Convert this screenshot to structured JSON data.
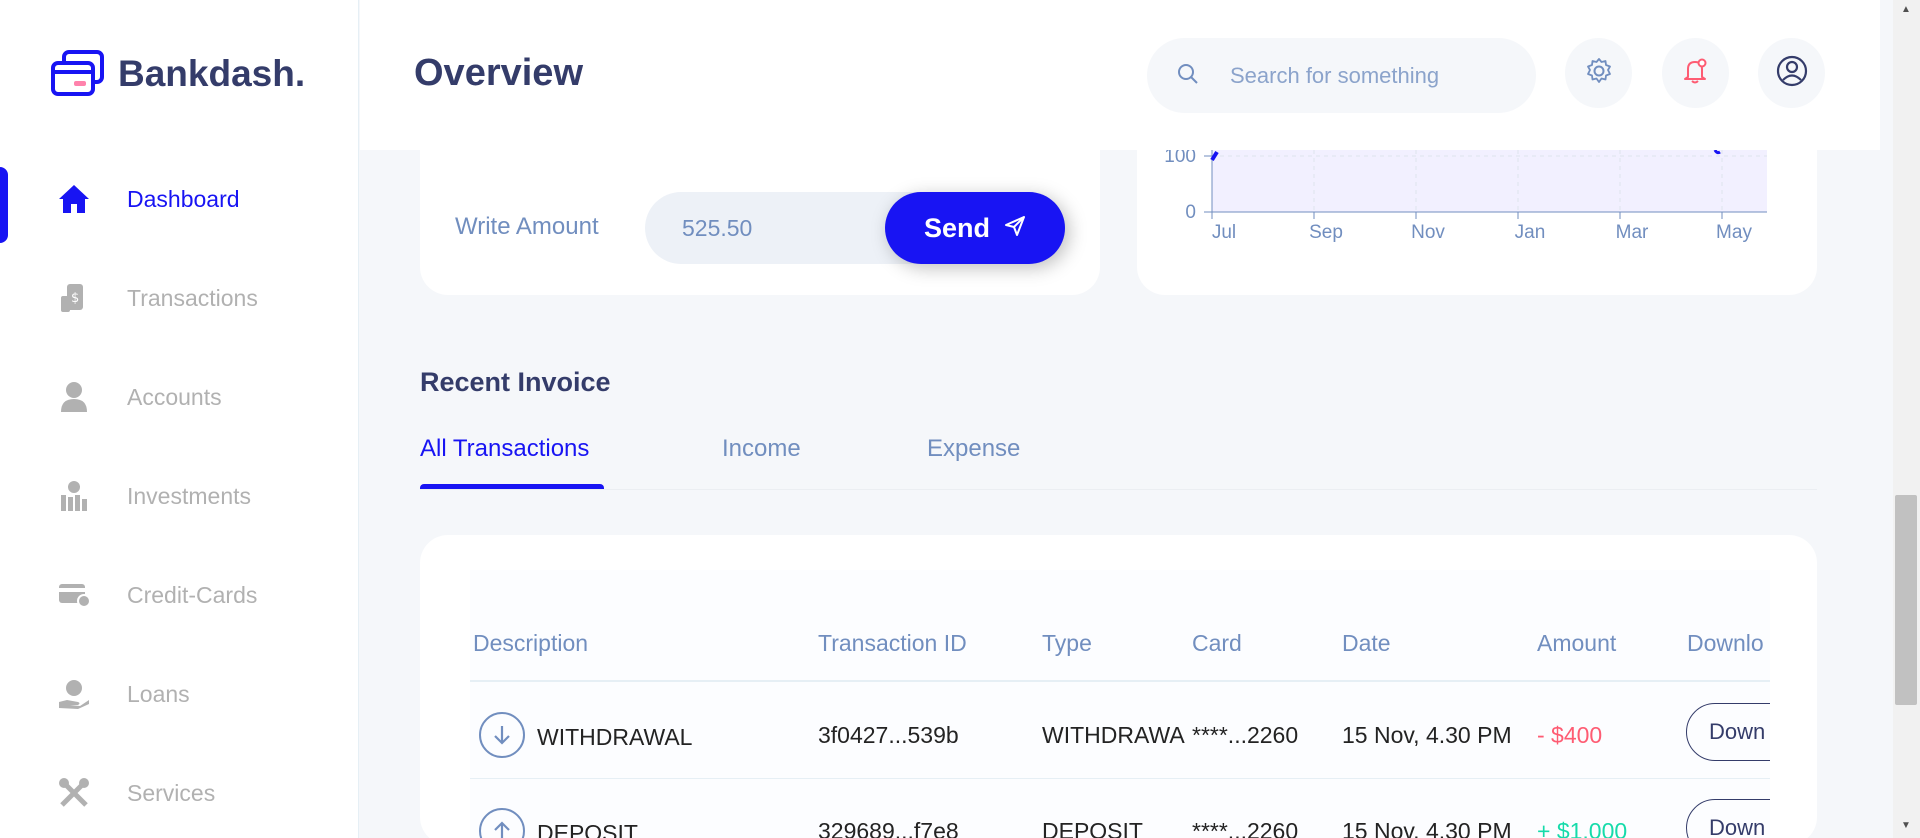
{
  "app": {
    "name": "Bankdash."
  },
  "sidebar": {
    "items": [
      {
        "label": "Dashboard",
        "icon": "home-icon",
        "active": true
      },
      {
        "label": "Transactions",
        "icon": "transfer-icon"
      },
      {
        "label": "Accounts",
        "icon": "user-icon"
      },
      {
        "label": "Investments",
        "icon": "investment-icon"
      },
      {
        "label": "Credit-Cards",
        "icon": "credit-card-icon"
      },
      {
        "label": "Loans",
        "icon": "loan-icon"
      },
      {
        "label": "Services",
        "icon": "services-icon"
      }
    ]
  },
  "header": {
    "title": "Overview",
    "search_placeholder": "Search for something",
    "icons": [
      "gear-icon",
      "notification-icon",
      "profile-icon"
    ]
  },
  "quick_transfer": {
    "amount_label": "Write Amount",
    "amount_value": "525.50",
    "send_label": "Send"
  },
  "chart": {
    "y_ticks": [
      "100",
      "0"
    ],
    "x_ticks": [
      "Jul",
      "Sep",
      "Nov",
      "Jan",
      "Mar",
      "May"
    ]
  },
  "chart_data": {
    "type": "line",
    "x": [
      "Jul",
      "Sep",
      "Nov",
      "Jan",
      "Mar",
      "May"
    ],
    "y_ticks": [
      0,
      100
    ],
    "grid": true,
    "accent": "#1814f3"
  },
  "invoice": {
    "title": "Recent Invoice",
    "tabs": [
      "All Transactions",
      "Income",
      "Expense"
    ],
    "active_tab": "All Transactions",
    "columns": [
      "Description",
      "Transaction ID",
      "Type",
      "Card",
      "Date",
      "Amount",
      "Downlo"
    ],
    "rows": [
      {
        "description": "WITHDRAWAL",
        "direction": "down-arrow-icon",
        "id": "3f0427...539b",
        "type": "WITHDRAWA",
        "card": "****...2260",
        "date": "15 Nov, 4.30 PM",
        "amount": "- $400",
        "download": "Down"
      },
      {
        "description": "DEPOSIT",
        "direction": "up-arrow-icon",
        "id": "329689...f7e8",
        "type": "DEPOSIT",
        "card": "****...2260",
        "date": "15 Nov, 4.30 PM",
        "amount": "+ $1,000",
        "download": "Down"
      }
    ]
  },
  "colors": {
    "accent": "#1814f3",
    "negative": "#fe5c73",
    "positive": "#16dbaa",
    "muted": "#718ebf",
    "heading": "#343c6a"
  }
}
